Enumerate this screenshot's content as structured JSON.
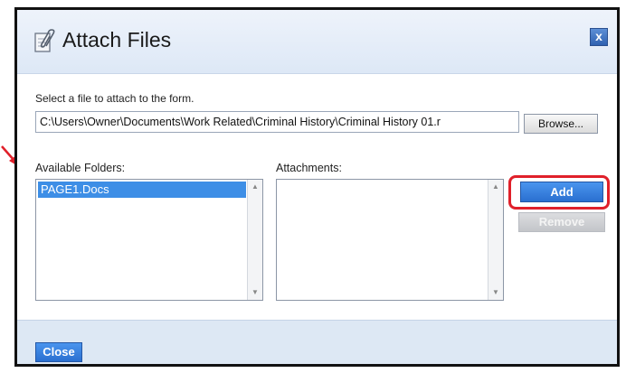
{
  "dialog": {
    "title": "Attach Files",
    "close_glyph": "x",
    "title_icon": "paperclip-document-icon"
  },
  "form": {
    "instruction": "Select a file to attach to the form.",
    "file_path": "C:\\Users\\Owner\\Documents\\Work Related\\Criminal History\\Criminal History 01.r",
    "browse_label": "Browse..."
  },
  "folders": {
    "label": "Available Folders:",
    "items": [
      "PAGE1.Docs"
    ],
    "selected": "PAGE1.Docs"
  },
  "attachments": {
    "label": "Attachments:",
    "items": []
  },
  "buttons": {
    "add": "Add",
    "remove": "Remove",
    "close": "Close"
  },
  "annotations": {
    "highlight_color": "#e0202a",
    "arrow_color": "#e0202a"
  },
  "colors": {
    "header_bg": "#dde8f6",
    "accent": "#2a6fd0",
    "selection": "#3d8ee6"
  }
}
